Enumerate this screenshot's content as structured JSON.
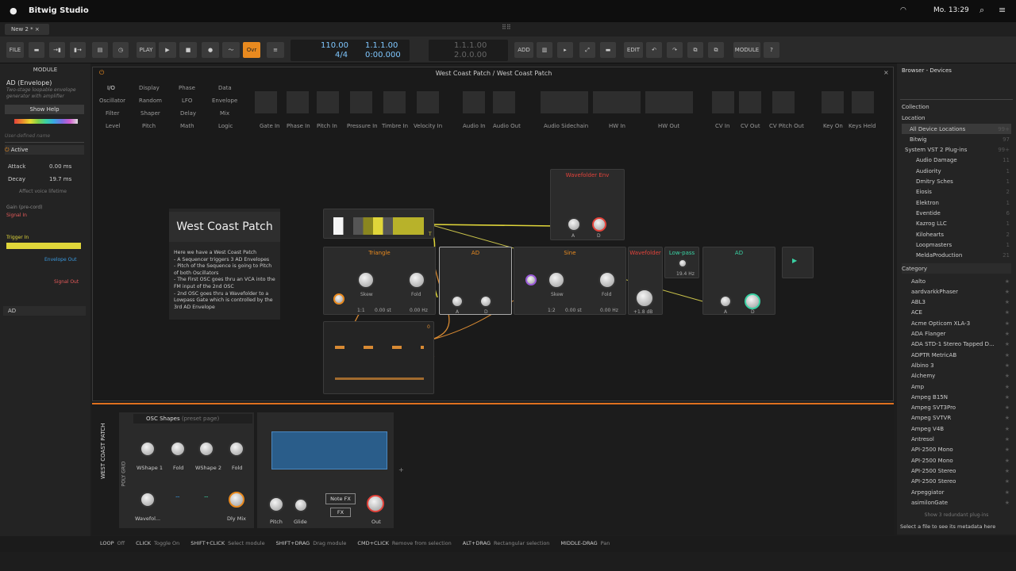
{
  "menubar": {
    "app": "Bitwig Studio",
    "datetime": "Mo. 13:29"
  },
  "tab": {
    "label": "New 2 *"
  },
  "toolbar": {
    "file": "FILE",
    "play_label": "PLAY",
    "ovr": "Ovr",
    "tempo": "110.00",
    "time_sig": "4/4",
    "position": "1.1.1.00",
    "time": "0:00.000",
    "loop_start": "1.1.1.00",
    "loop_len": "2.0.0.00",
    "add": "ADD",
    "edit": "EDIT",
    "module": "MODULE"
  },
  "inspector": {
    "header": "MODULE",
    "name": "AD (Envelope)",
    "desc": "Two-stage loopable envelope generator with amplifier",
    "help": "Show Help",
    "user_name": "User-defined name",
    "active": "Active",
    "attack_label": "Attack",
    "attack_val": "0.00 ms",
    "decay_label": "Decay",
    "decay_val": "19.7 ms",
    "affect": "Affect voice lifetime",
    "gain": "Gain (pre-cord)",
    "signal_in": "Signal In",
    "trigger_in": "Trigger In",
    "env_out": "Envelope Out",
    "signal_out": "Signal Out",
    "footer": "AD"
  },
  "grid": {
    "title": "West Coast Patch / West Coast Patch",
    "categories": [
      [
        "I/O",
        "Display",
        "Phase",
        "Data"
      ],
      [
        "Oscillator",
        "Random",
        "LFO",
        "Envelope"
      ],
      [
        "Filter",
        "Shaper",
        "Delay",
        "Mix"
      ],
      [
        "Level",
        "Pitch",
        "Math",
        "Logic"
      ]
    ],
    "io": [
      "Gate In",
      "Phase In",
      "Pitch In",
      "Pressure In",
      "Timbre In",
      "Velocity In",
      "Audio In",
      "Audio Out",
      "Audio Sidechain",
      "HW In",
      "HW Out",
      "CV In",
      "CV Out",
      "CV Pitch Out",
      "Key On",
      "Keys Held"
    ],
    "note_title": "West Coast Patch",
    "note_text": "Here we have a West Coast Patch\n- A Sequencer triggers 3 AD Envelopes\n- Pitch of the Sequence is going to Pitch of both Oscillators\n- The First OSC goes thru an VCA into the FM input of the 2nd OSC\n- 2nd OSC goes thru a Wavefolder to a Lowpass Gate which is controlled by the 3rd AD Envelope",
    "tri": {
      "title": "Triangle",
      "skew": "Skew",
      "fold": "Fold",
      "ratio": "1:1",
      "st": "0.00 st",
      "hz": "0.00 Hz"
    },
    "ad1": {
      "title": "AD",
      "a": "A",
      "d": "D"
    },
    "sine": {
      "title": "Sine",
      "skew": "Skew",
      "fold": "Fold",
      "ratio": "1:2",
      "st": "0.00 st",
      "hz": "0.00 Hz"
    },
    "wf": {
      "title": "Wavefolder",
      "db": "+1.8 dB"
    },
    "lp": {
      "title": "Low-pass",
      "hz": "19.4 Hz"
    },
    "ad3": {
      "title": "AD",
      "a": "A",
      "d": "D"
    },
    "wfenv": {
      "title": "Wavefolder Env",
      "a": "A",
      "d": "D"
    },
    "seq": {
      "t": "T",
      "zero": "0"
    }
  },
  "device": {
    "side_label": "WEST COAST PATCH",
    "poly": "POLY GRID",
    "preset": "OSC Shapes",
    "preset_note": "(preset page)",
    "knobs": [
      "WShape 1",
      "Fold",
      "WShape 2",
      "Fold",
      "Wavefol...",
      "",
      "",
      "Dly Mix"
    ],
    "pitch": "Pitch",
    "glide": "Glide",
    "notefx": "Note FX",
    "fx": "FX",
    "out": "Out"
  },
  "browser": {
    "title": "Browser - Devices",
    "collection": "Collection",
    "location": "Location",
    "locations": [
      [
        "All Device Locations",
        "99+"
      ],
      [
        "Bitwig",
        "97"
      ],
      [
        "System VST 2 Plug-ins",
        "99+"
      ],
      [
        "Audio Damage",
        "11"
      ],
      [
        "Audiority",
        "1"
      ],
      [
        "Dmitry Sches",
        "1"
      ],
      [
        "Eiosis",
        "2"
      ],
      [
        "Elektron",
        "1"
      ],
      [
        "Eventide",
        "6"
      ],
      [
        "Kazrog LLC",
        "1"
      ],
      [
        "Kilohearts",
        "2"
      ],
      [
        "Loopmasters",
        "1"
      ],
      [
        "MeldaProduction",
        "21"
      ]
    ],
    "category": "Category",
    "items": [
      "Aalto",
      "aardvarkkPhaser",
      "ABL3",
      "ACE",
      "Acme Opticom XLA-3",
      "ADA Flanger",
      "ADA STD-1 Stereo Tapped D...",
      "ADPTR MetricAB",
      "Albino 3",
      "Alchemy",
      "Amp",
      "Ampeg B15N",
      "Ampeg SVT3Pro",
      "Ampeg SVTVR",
      "Ampeg V4B",
      "Antresol",
      "API-2500 Mono",
      "API-2500 Mono",
      "API-2500 Stereo",
      "API-2500 Stereo",
      "Arpeggiator",
      "asimilonGate"
    ],
    "redundant": "Show 3 redundant plug-ins",
    "footer": "Select a file to see its metadata here"
  },
  "status": [
    [
      "LOOP",
      "Off"
    ],
    [
      "CLICK",
      "Toggle On"
    ],
    [
      "SHIFT+CLICK",
      "Select module"
    ],
    [
      "SHIFT+DRAG",
      "Drag module"
    ],
    [
      "CMD+CLICK",
      "Remove from selection"
    ],
    [
      "ALT+DRAG",
      "Rectangular selection"
    ],
    [
      "MIDDLE-DRAG",
      "Pan"
    ]
  ]
}
